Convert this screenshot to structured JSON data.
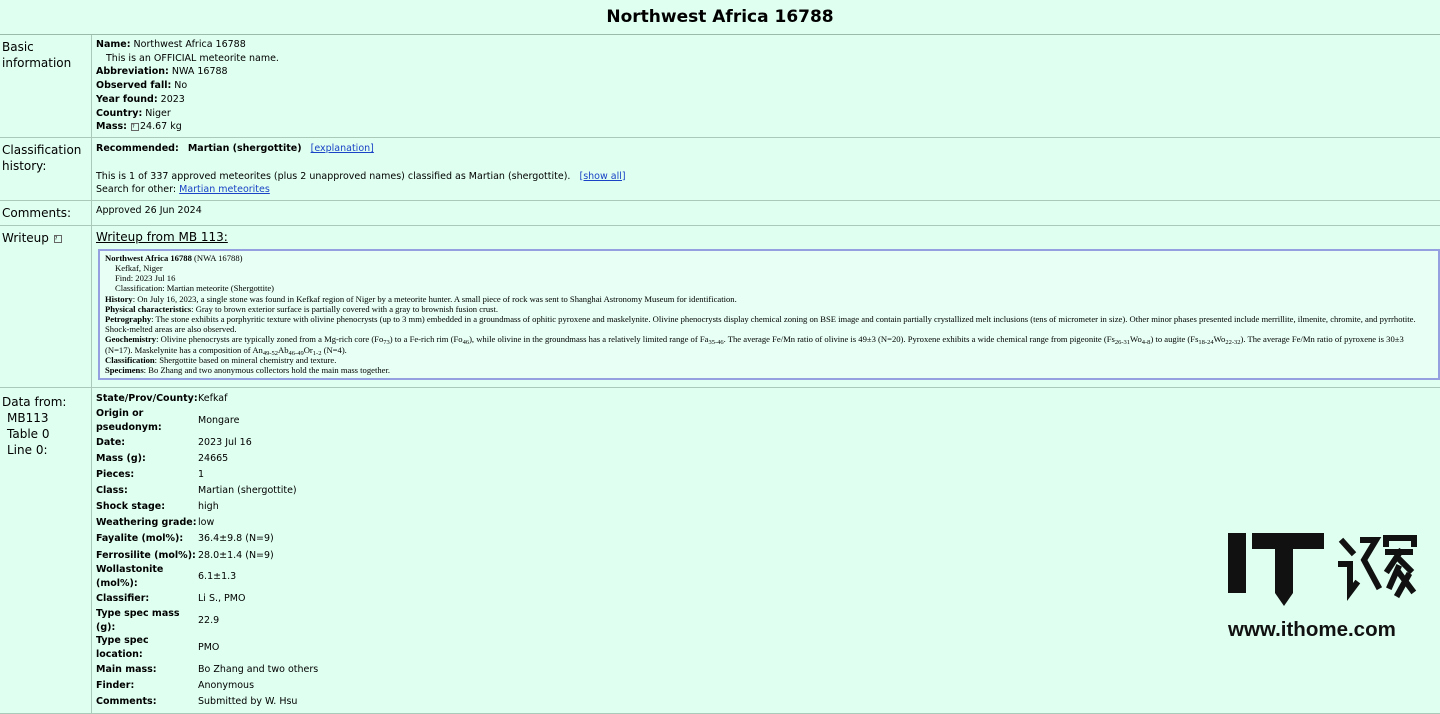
{
  "page_title": "Northwest Africa 16788",
  "basic": {
    "label": "Basic information",
    "name_label": "Name:",
    "name": "Northwest Africa 16788",
    "official_note": "This is an OFFICIAL meteorite name.",
    "abbr_label": "Abbreviation:",
    "abbr": "NWA 16788",
    "fall_label": "Observed fall:",
    "fall": "No",
    "year_label": "Year found:",
    "year": "2023",
    "country_label": "Country:",
    "country": "Niger",
    "mass_label": "Mass:",
    "mass": "24.67 kg"
  },
  "classification": {
    "label": "Classification history:",
    "recommended_label": "Recommended:",
    "recommended": "Martian (shergottite)",
    "explanation_link": "[explanation]",
    "summary": "This is 1 of 337 approved meteorites (plus 2 unapproved names) classified as Martian (shergottite).",
    "show_all_link": "[show all]",
    "search_label": "Search for other:",
    "search_link": "Martian meteorites"
  },
  "comments": {
    "label": "Comments:",
    "text": "Approved 26 Jun 2024"
  },
  "writeup": {
    "label": "Writeup",
    "link": "Writeup from MB 113:",
    "title": "Northwest Africa 16788",
    "title_abbr": "(NWA 16788)",
    "location": "Kefkaf, Niger",
    "find": "Find: 2023 Jul 16",
    "classification": "Classification: Martian meteorite (Shergottite)",
    "history_label": "History",
    "history": ": On July 16, 2023, a single stone was found in Kefkaf region of Niger by a meteorite hunter. A small piece of rock was sent to Shanghai Astronomy Museum for identification.",
    "physical_label": "Physical characteristics",
    "physical": ": Gray to brown exterior surface is partially covered with a gray to brownish fusion crust.",
    "petrography_label": "Petrography",
    "petrography": ": The stone exhibits a porphyritic texture with olivine phenocrysts (up to 3 mm) embedded in a groundmass of ophitic pyroxene and maskelynite. Olivine phenocrysts display chemical zoning on BSE image and contain partially crystallized melt inclusions (tens of micrometer in size). Other minor phases presented include merrillite, ilmenite, chromite, and pyrrhotite. Shock-melted areas are also observed.",
    "geochem_label": "Geochemistry",
    "geochem_1": ": Olivine phenocrysts are typically zoned from a Mg-rich core (Fo",
    "geochem_s1": "73",
    "geochem_2": ") to a Fe-rich rim (Fo",
    "geochem_s2": "46",
    "geochem_3": "), while olivine in the groundmass has a relatively limited range of Fa",
    "geochem_s3": "35-46",
    "geochem_4": ". The average Fe/Mn ratio of olivine is 49±3 (N=20). Pyroxene exhibits a wide chemical range from pigeonite (Fs",
    "geochem_s4": "26-31",
    "geochem_5": "Wo",
    "geochem_s5": "4-8",
    "geochem_6": ") to augite (Fs",
    "geochem_s6": "18-24",
    "geochem_7": "Wo",
    "geochem_s7": "22-32",
    "geochem_8": "). The average Fe/Mn ratio of pyroxene is 30±3 (N=17). Maskelynite has a composition of An",
    "geochem_s8": "49-52",
    "geochem_9": "Ab",
    "geochem_s9": "46-49",
    "geochem_10": "Or",
    "geochem_s10": "1-2",
    "geochem_11": " (N=4).",
    "class_label": "Classification",
    "class_text": ": Shergottite based on mineral chemistry and texture.",
    "specimens_label": "Specimens",
    "specimens": ": Bo Zhang and two anonymous collectors hold the main mass together."
  },
  "data_from": {
    "label_1": "Data from:",
    "label_2": "MB113",
    "label_3": "Table 0",
    "label_4": "Line 0:",
    "rows": [
      {
        "k": "State/Prov/County:",
        "v": "Kefkaf"
      },
      {
        "k": "Origin or pseudonym:",
        "v": "Mongare"
      },
      {
        "k": "Date:",
        "v": "2023 Jul 16"
      },
      {
        "k": "Mass (g):",
        "v": "24665"
      },
      {
        "k": "Pieces:",
        "v": "1"
      },
      {
        "k": "Class:",
        "v": "Martian (shergottite)"
      },
      {
        "k": "Shock stage:",
        "v": "high"
      },
      {
        "k": "Weathering grade:",
        "v": "low"
      },
      {
        "k": "Fayalite (mol%):",
        "v": "36.4±9.8 (N=9)"
      },
      {
        "k": "Ferrosilite (mol%):",
        "v": "28.0±1.4 (N=9)"
      },
      {
        "k": "Wollastonite (mol%):",
        "v": "6.1±1.3"
      },
      {
        "k": "Classifier:",
        "v": "Li S., PMO"
      },
      {
        "k": "Type spec mass (g):",
        "v": "22.9"
      },
      {
        "k": "Type spec location:",
        "v": "PMO"
      },
      {
        "k": "Main mass:",
        "v": "Bo Zhang and two others"
      },
      {
        "k": "Finder:",
        "v": "Anonymous"
      },
      {
        "k": "Comments:",
        "v": "Submitted by W. Hsu"
      }
    ]
  },
  "watermark": {
    "logo_text": "IT",
    "logo_cn": "之家",
    "url": "www.ithome.com"
  }
}
